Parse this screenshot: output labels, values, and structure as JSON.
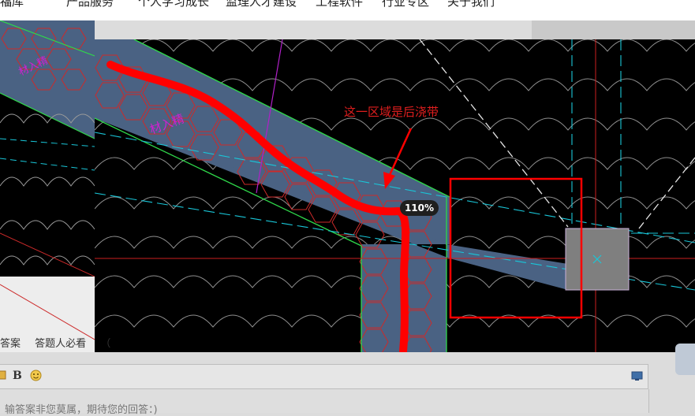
{
  "nav": {
    "items": [
      "产品服务",
      "个人学习成长",
      "监理人才建设",
      "工程软件",
      "行业专区",
      "关于我们"
    ]
  },
  "thread": {
    "tabs": [
      "答案",
      "答题人必看",
      "（"
    ]
  },
  "editor": {
    "bold_label": "B",
    "placeholder": "输答案非您莫属，期待您的回答：)"
  },
  "image": {
    "annotation": "这一区域是后浇带",
    "zoom_label": "110%",
    "label_left": "材入精",
    "label_main": "材入精"
  },
  "colors": {
    "cad_bg": "#000000",
    "slab_fill": "#4a6283",
    "hatch": "#cc2a2a",
    "red_markup": "#ff0000",
    "cyan_axis": "#19c6d8",
    "green_edge": "#2fd84a"
  }
}
